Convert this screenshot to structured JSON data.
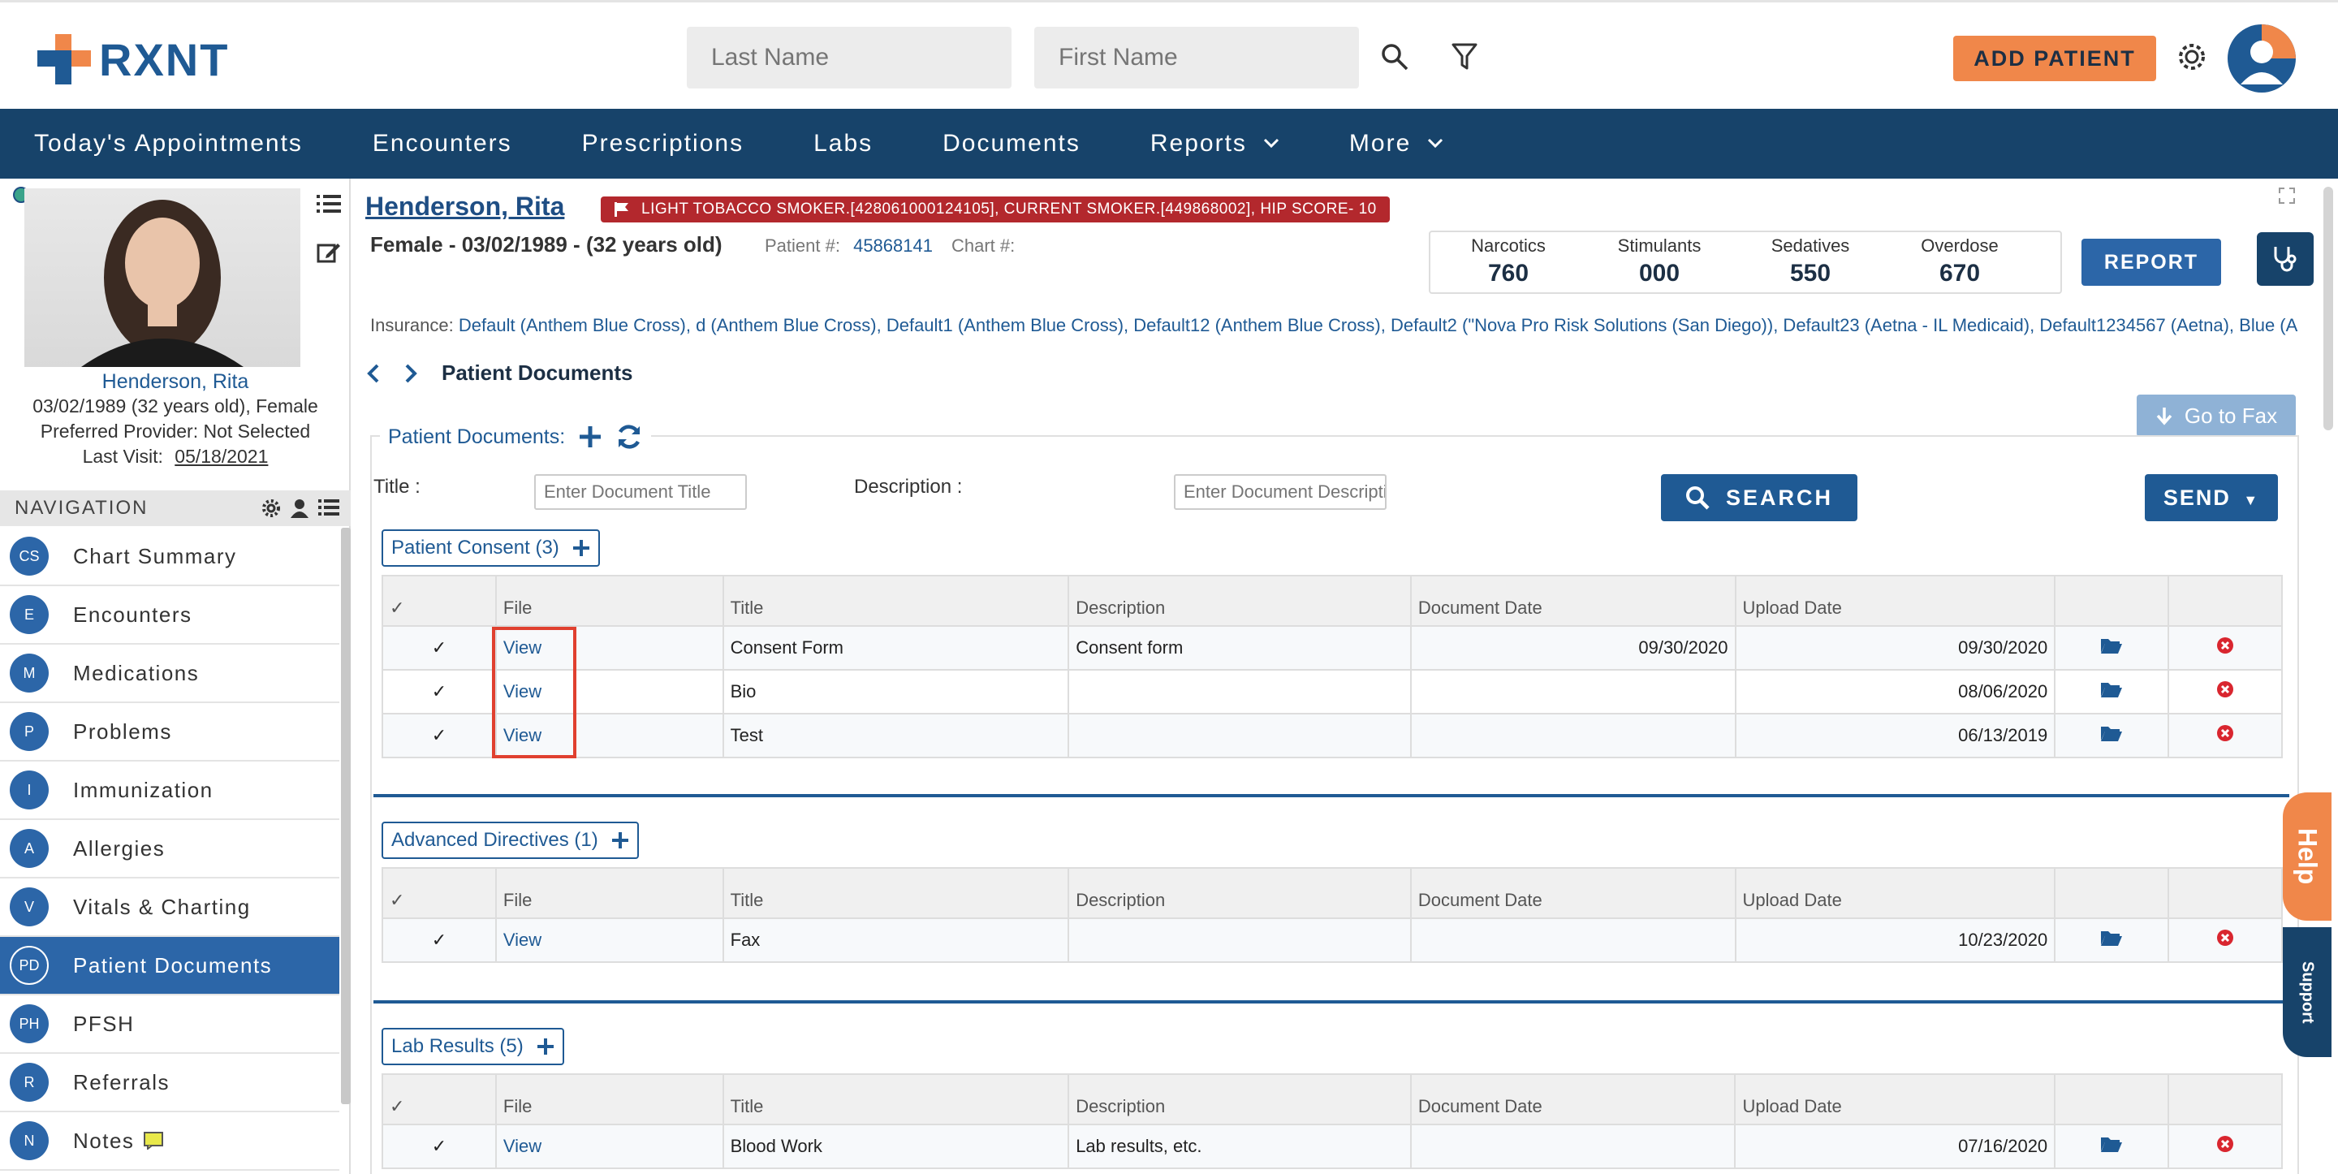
{
  "header": {
    "logo_text": "RXNT",
    "last_name_placeholder": "Last Name",
    "first_name_placeholder": "First Name",
    "add_patient_label": "ADD PATIENT"
  },
  "nav": {
    "items": [
      "Today's Appointments",
      "Encounters",
      "Prescriptions",
      "Labs",
      "Documents",
      "Reports",
      "More"
    ]
  },
  "patient": {
    "name": "Henderson, Rita",
    "age_gender": "03/02/1989 (32 years old), Female",
    "preferred_provider": "Preferred Provider: Not Selected",
    "last_visit_label": "Last Visit:",
    "last_visit": "05/18/2021",
    "summary": "Female - 03/02/1989 - (32 years old)",
    "patient_no_label": "Patient #:",
    "patient_no": "45868141",
    "chart_no_label": "Chart #:",
    "flags": "LIGHT TOBACCO SMOKER.[428061000124105], CURRENT SMOKER.[449868002], HIP SCORE- 10",
    "insurance_label": "Insurance:",
    "insurance": "Default (Anthem Blue Cross), d (Anthem Blue Cross), Default1 (Anthem Blue Cross), Default12 (Anthem Blue Cross), Default2 (\"Nova Pro Risk Solutions (San Diego)), Default23 (Aetna - IL Medicaid), Default1234567 (Aetna), Blue (A"
  },
  "pdmp": {
    "cols": [
      {
        "label": "Narcotics",
        "value": "760"
      },
      {
        "label": "Stimulants",
        "value": "000"
      },
      {
        "label": "Sedatives",
        "value": "550"
      },
      {
        "label": "Overdose",
        "value": "670"
      }
    ],
    "report_label": "REPORT"
  },
  "sidenav": {
    "title": "NAVIGATION",
    "items": [
      {
        "badge": "CS",
        "label": "Chart Summary"
      },
      {
        "badge": "E",
        "label": "Encounters"
      },
      {
        "badge": "M",
        "label": "Medications"
      },
      {
        "badge": "P",
        "label": "Problems"
      },
      {
        "badge": "I",
        "label": "Immunization"
      },
      {
        "badge": "A",
        "label": "Allergies"
      },
      {
        "badge": "V",
        "label": "Vitals & Charting"
      },
      {
        "badge": "PD",
        "label": "Patient Documents"
      },
      {
        "badge": "PH",
        "label": "PFSH"
      },
      {
        "badge": "R",
        "label": "Referrals"
      },
      {
        "badge": "N",
        "label": "Notes"
      }
    ]
  },
  "docs": {
    "breadcrumb": "Patient Documents",
    "go_to_fax": "Go to Fax",
    "panel_label": "Patient Documents:",
    "title_label": "Title :",
    "title_placeholder": "Enter Document Title",
    "desc_label": "Description :",
    "desc_placeholder": "Enter Document Description",
    "search_label": "SEARCH",
    "send_label": "SEND",
    "columns": [
      "File",
      "Title",
      "Description",
      "Document Date",
      "Upload Date"
    ],
    "view_label": "View",
    "sections": [
      {
        "name": "Patient Consent (3)",
        "rows": [
          {
            "title": "Consent Form",
            "description": "Consent form",
            "doc_date": "09/30/2020",
            "upload_date": "09/30/2020"
          },
          {
            "title": "Bio",
            "description": "",
            "doc_date": "",
            "upload_date": "08/06/2020"
          },
          {
            "title": "Test",
            "description": "",
            "doc_date": "",
            "upload_date": "06/13/2019"
          }
        ]
      },
      {
        "name": "Advanced Directives (1)",
        "rows": [
          {
            "title": "Fax",
            "description": "",
            "doc_date": "",
            "upload_date": "10/23/2020"
          }
        ]
      },
      {
        "name": "Lab Results (5)",
        "rows": [
          {
            "title": "Blood Work",
            "description": "Lab results, etc.",
            "doc_date": "",
            "upload_date": "07/16/2020"
          }
        ]
      }
    ]
  },
  "widgets": {
    "help": "Help",
    "support": "Support"
  },
  "colors": {
    "primary": "#1f5a94",
    "nav_bg": "#17436a",
    "accent": "#f0874a",
    "flag": "#b3282d"
  }
}
